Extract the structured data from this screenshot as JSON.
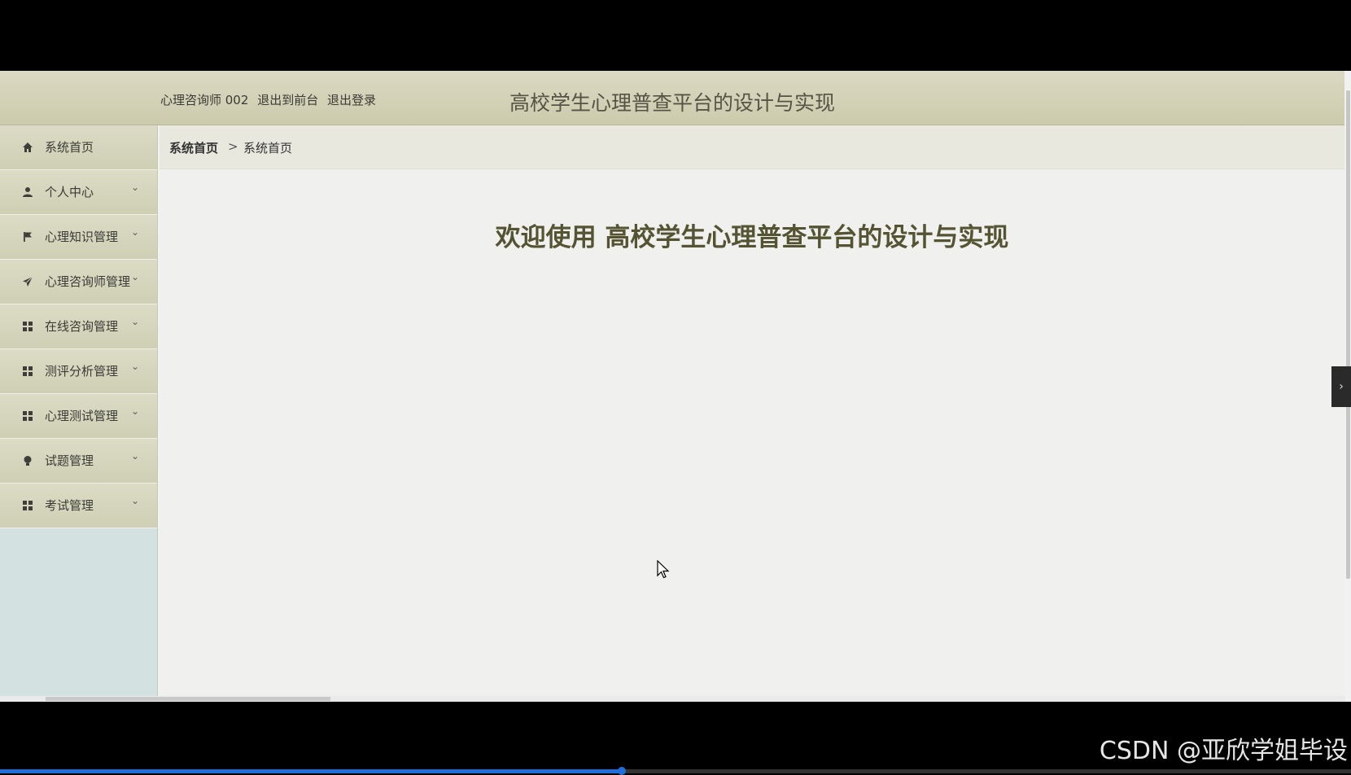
{
  "topbar": {
    "user_name": "心理咨询师 002",
    "to_frontend": "退出到前台",
    "logout": "退出登录",
    "site_title": "高校学生心理普查平台的设计与实现"
  },
  "sidebar": {
    "items": [
      {
        "label": "系统首页",
        "icon": "home-icon",
        "expandable": false
      },
      {
        "label": "个人中心",
        "icon": "user-icon",
        "expandable": true
      },
      {
        "label": "心理知识管理",
        "icon": "flag-icon",
        "expandable": true
      },
      {
        "label": "心理咨询师管理",
        "icon": "paper-plane-icon",
        "expandable": true
      },
      {
        "label": "在线咨询管理",
        "icon": "grid-icon",
        "expandable": true
      },
      {
        "label": "测评分析管理",
        "icon": "grid-icon",
        "expandable": true
      },
      {
        "label": "心理测试管理",
        "icon": "grid-icon",
        "expandable": true
      },
      {
        "label": "试题管理",
        "icon": "bulb-icon",
        "expandable": true
      },
      {
        "label": "考试管理",
        "icon": "grid-icon",
        "expandable": true
      }
    ]
  },
  "breadcrumb": {
    "home": "系统首页",
    "separator": ">",
    "current": "系统首页"
  },
  "main": {
    "welcome": "欢迎使用 高校学生心理普查平台的设计与实现"
  },
  "video": {
    "progress_fraction": 0.46
  },
  "watermark": "CSDN @亚欣学姐毕设",
  "colors": {
    "accent": "#545332",
    "topbar": "#d3d2b6",
    "sidebar_bg": "#d3e2e1",
    "progress": "#1e6fd9"
  }
}
